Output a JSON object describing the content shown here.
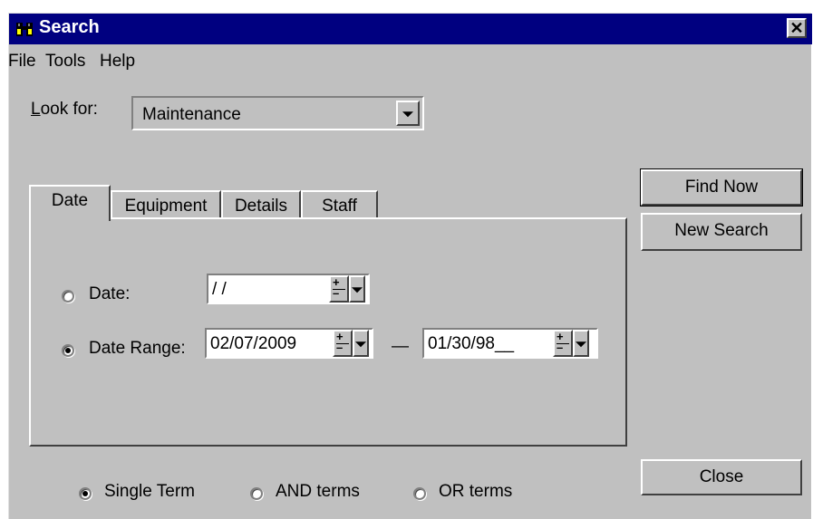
{
  "window": {
    "title": "Search"
  },
  "menu": {
    "file": "File",
    "tools": "Tools",
    "help": "Help"
  },
  "look_for": {
    "label_prefix": "L",
    "label_rest": "ook for:",
    "value": "Maintenance"
  },
  "tabs": [
    {
      "label": "Date"
    },
    {
      "label": "Equipment"
    },
    {
      "label": "Details"
    },
    {
      "label": "Staff"
    }
  ],
  "date_tab": {
    "date_label": "Date:",
    "date_value": "/ /",
    "range_label": "Date Range:",
    "range_from": "02/07/2009",
    "range_separator": "—",
    "range_to": "01/30/98__"
  },
  "buttons": {
    "find_now": "Find Now",
    "new_search": "New Search",
    "close": "Close"
  },
  "term_options": {
    "single": "Single Term",
    "and": "AND terms",
    "or": "OR terms"
  },
  "colors": {
    "titlebar": "#000080",
    "face": "#c0c0c0"
  }
}
